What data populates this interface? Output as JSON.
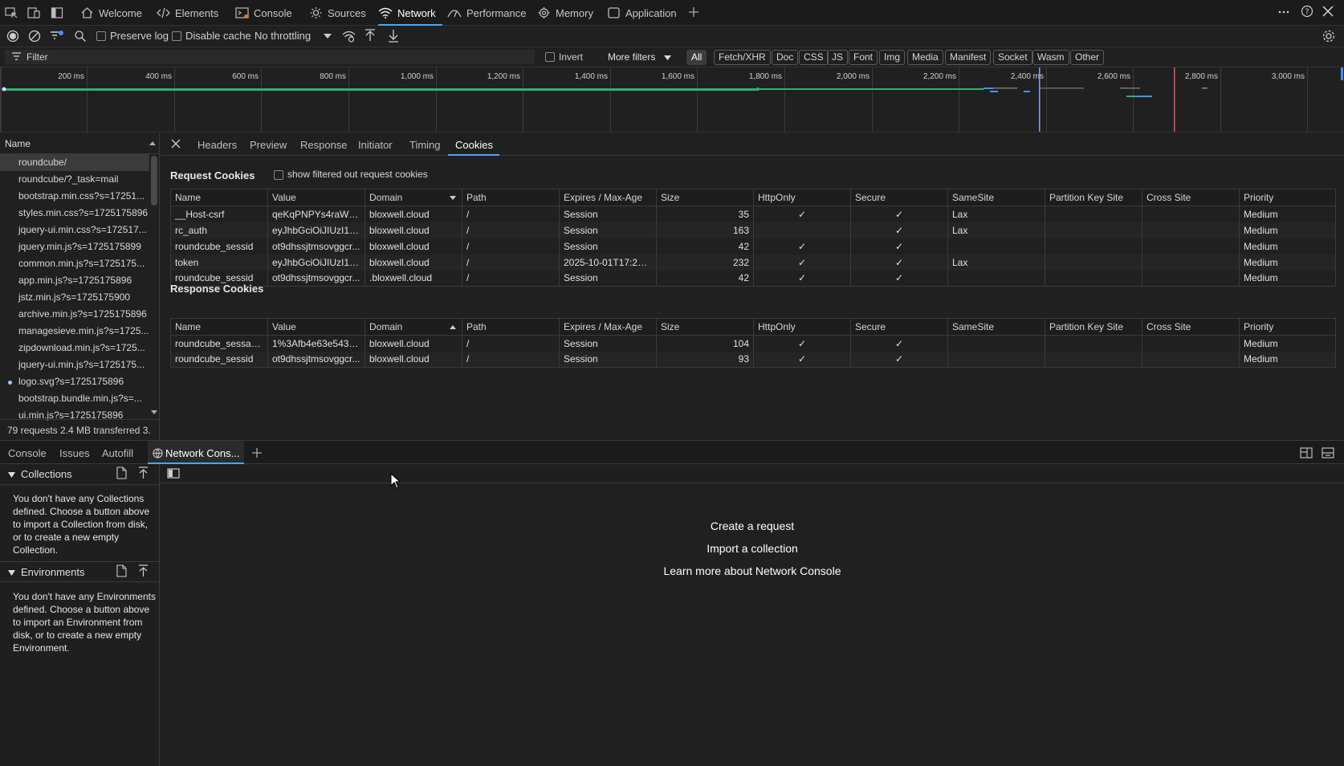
{
  "top_tabs": [
    {
      "label": "Welcome",
      "icon": "home-icon"
    },
    {
      "label": "Elements",
      "icon": "code-icon"
    },
    {
      "label": "Console",
      "icon": "console-icon"
    },
    {
      "label": "Sources",
      "icon": "bug-icon"
    },
    {
      "label": "Network",
      "icon": "wifi-icon",
      "active": true
    },
    {
      "label": "Performance",
      "icon": "performance-icon"
    },
    {
      "label": "Memory",
      "icon": "memory-icon"
    },
    {
      "label": "Application",
      "icon": "application-icon"
    }
  ],
  "toolbar": {
    "preserve_log": "Preserve log",
    "disable_cache": "Disable cache",
    "throttling": "No throttling"
  },
  "filter": {
    "placeholder": "Filter",
    "invert": "Invert",
    "more_filters": "More filters",
    "types": [
      "All",
      "Fetch/XHR",
      "Doc",
      "CSS",
      "JS",
      "Font",
      "Img",
      "Media",
      "Manifest",
      "Socket",
      "Wasm",
      "Other"
    ],
    "active_type": "All"
  },
  "timeline": {
    "ticks": [
      "200 ms",
      "400 ms",
      "600 ms",
      "800 ms",
      "1,000 ms",
      "1,200 ms",
      "1,400 ms",
      "1,600 ms",
      "1,800 ms",
      "2,000 ms",
      "2,200 ms",
      "2,400 ms",
      "2,600 ms",
      "2,800 ms",
      "3,000 ms"
    ]
  },
  "request_list": {
    "header": "Name",
    "items": [
      "roundcube/",
      "roundcube/?_task=mail",
      "bootstrap.min.css?s=17251...",
      "styles.min.css?s=1725175896",
      "jquery-ui.min.css?s=172517...",
      "jquery.min.js?s=1725175899",
      "common.min.js?s=1725175...",
      "app.min.js?s=1725175896",
      "jstz.min.js?s=1725175900",
      "archive.min.js?s=1725175896",
      "managesieve.min.js?s=1725...",
      "zipdownload.min.js?s=1725...",
      "jquery-ui.min.js?s=1725175...",
      "logo.svg?s=1725175896",
      "bootstrap.bundle.min.js?s=...",
      "ui.min.js?s=1725175896"
    ],
    "footer": "79 requests   2.4 MB transferred   3."
  },
  "detail_tabs": [
    "Headers",
    "Preview",
    "Response",
    "Initiator",
    "Timing",
    "Cookies"
  ],
  "detail_active": "Cookies",
  "request_cookies": {
    "title": "Request Cookies",
    "show_filtered": "show filtered out request cookies",
    "columns": [
      "Name",
      "Value",
      "Domain",
      "Path",
      "Expires / Max-Age",
      "Size",
      "HttpOnly",
      "Secure",
      "SameSite",
      "Partition Key Site",
      "Cross Site",
      "Priority"
    ],
    "rows": [
      [
        "__Host-csrf",
        "qeKqPNPYs4raWDk...",
        "bloxwell.cloud",
        "/",
        "Session",
        "35",
        "✓",
        "✓",
        "Lax",
        "",
        "",
        "Medium"
      ],
      [
        "rc_auth",
        "eyJhbGciOiJIUzI1Ni...",
        "bloxwell.cloud",
        "/",
        "Session",
        "163",
        "",
        "✓",
        "Lax",
        "",
        "",
        "Medium"
      ],
      [
        "roundcube_sessid",
        "ot9dhssjtmsovggcr...",
        "bloxwell.cloud",
        "/",
        "Session",
        "42",
        "✓",
        "✓",
        "",
        "",
        "",
        "Medium"
      ],
      [
        "token",
        "eyJhbGciOiJIUzI1Ni...",
        "bloxwell.cloud",
        "/",
        "2025-10-01T17:20:...",
        "232",
        "✓",
        "✓",
        "Lax",
        "",
        "",
        "Medium"
      ],
      [
        "roundcube_sessid",
        "ot9dhssjtmsovggcr...",
        ".bloxwell.cloud",
        "/",
        "Session",
        "42",
        "✓",
        "✓",
        "",
        "",
        "",
        "Medium"
      ]
    ]
  },
  "response_cookies": {
    "title": "Response Cookies",
    "columns": [
      "Name",
      "Value",
      "Domain",
      "Path",
      "Expires / Max-Age",
      "Size",
      "HttpOnly",
      "Secure",
      "SameSite",
      "Partition Key Site",
      "Cross Site",
      "Priority"
    ],
    "rows": [
      [
        "roundcube_sessauth",
        "1%3Afb4e63e5432...",
        "bloxwell.cloud",
        "/",
        "Session",
        "104",
        "✓",
        "✓",
        "",
        "",
        "",
        "Medium"
      ],
      [
        "roundcube_sessid",
        "ot9dhssjtmsovggcr...",
        "bloxwell.cloud",
        "/",
        "Session",
        "93",
        "✓",
        "✓",
        "",
        "",
        "",
        "Medium"
      ]
    ]
  },
  "drawer": {
    "tabs": [
      "Console",
      "Issues",
      "Autofill",
      "Network Cons..."
    ],
    "active_tab": "Network Cons...",
    "collections": {
      "title": "Collections",
      "text": "You don't have any Collections defined. Choose a button above to import a Collection from disk, or to create a new empty Collection."
    },
    "environments": {
      "title": "Environments",
      "text": "You don't have any Environments defined. Choose a button above to import an Environment from disk, or to create a new empty Environment."
    },
    "links": [
      "Create a request",
      "Import a collection",
      "Learn more about Network Console"
    ]
  },
  "colors": {
    "accent": "#4da3ff",
    "timeline_green": "#2fb36b",
    "timeline_blue": "#4d8cff"
  }
}
